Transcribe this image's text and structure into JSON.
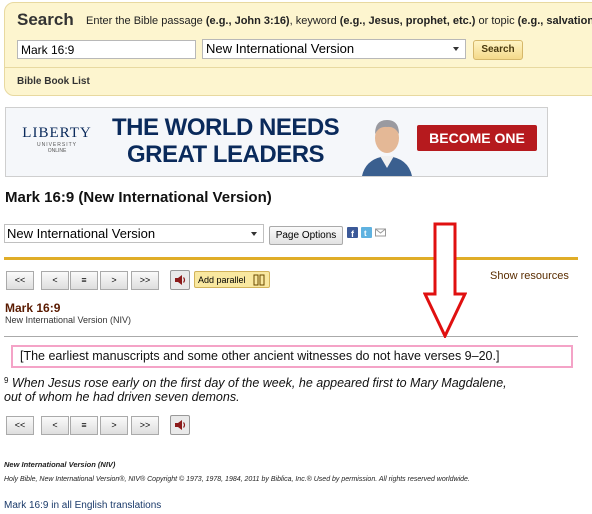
{
  "search": {
    "title": "Search",
    "hint_pre": "Enter the Bible passage ",
    "hint_ex1": "(e.g., John 3:16)",
    "hint_mid": ", keyword ",
    "hint_ex2": "(e.g., Jesus, prophet, etc.)",
    "hint_post": " or topic ",
    "hint_ex3": "(e.g., salvation",
    "passage_value": "Mark 16:9",
    "version_value": "New International Version",
    "button_label": "Search",
    "book_list_label": "Bible Book List"
  },
  "ad": {
    "logo_name": "LIBERTY",
    "logo_sub": "UNIVERSITY",
    "logo_online": "ONLINE",
    "headline_1": "THE WORLD NEEDS",
    "headline_2": "GREAT LEADERS",
    "cta": "BECOME ONE"
  },
  "page": {
    "title": "Mark 16:9 (New International Version)",
    "version_select": "New International Version",
    "page_options": "Page Options"
  },
  "toolbar": {
    "first": "<<",
    "prev": "<",
    "list": "≡",
    "next": ">",
    "last": ">>",
    "add_parallel": "Add parallel",
    "show_resources": "Show resources"
  },
  "passage": {
    "ref": "Mark 16:9",
    "version": "New International Version (NIV)",
    "footnote": "[The earliest manuscripts and some other ancient witnesses do not have verses 9–20.]",
    "verse_num": "9",
    "verse_line_1": " When Jesus rose early on the first day of the week, he appeared first to Mary Magdalene,",
    "verse_line_2": "out of whom he had driven seven demons."
  },
  "copyright": {
    "version": "New International Version (NIV)",
    "text": "Holy Bible, New International Version®, NIV® Copyright © 1973, 1978, 1984, 2011 by Biblica, Inc.® Used by permission. All rights reserved worldwide.",
    "all_translations": "Mark 16:9 in all English translations"
  },
  "colors": {
    "gold_rule": "#e0ad28",
    "footnote_border": "#f4a3c7",
    "arrow": "#e01010"
  }
}
